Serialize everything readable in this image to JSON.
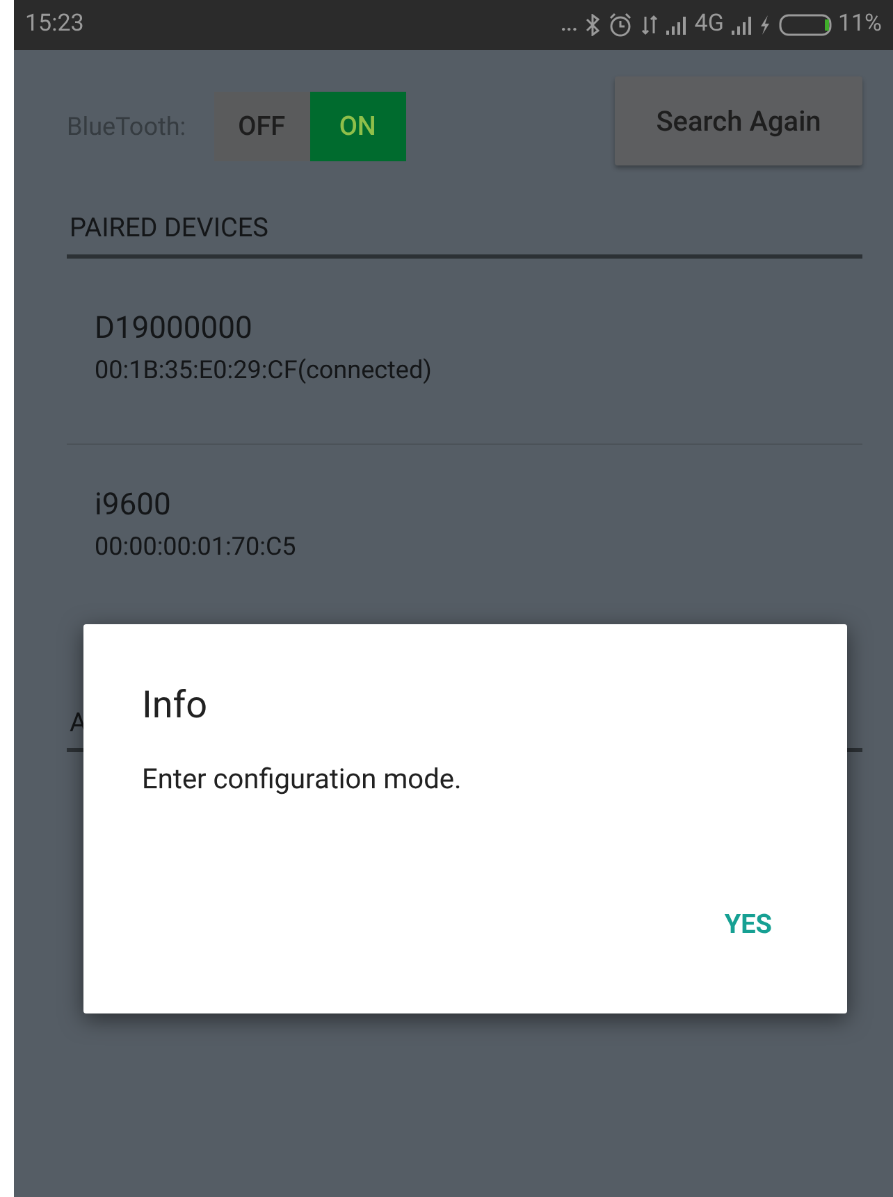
{
  "status_bar": {
    "dots": "...",
    "time": "15:23",
    "network": "4G",
    "battery": "11%"
  },
  "bluetooth": {
    "label": "BlueTooth:",
    "toggle": [
      {
        "label": "OFF",
        "selected": false
      },
      {
        "label": "ON",
        "selected": true
      }
    ]
  },
  "search_button": "Search Again",
  "sections": [
    {
      "title": "PAIRED DEVICES",
      "devices": [
        {
          "name": "D19000000",
          "address": "00:1B:35:E0:29:CF(connected)"
        },
        {
          "name": "i9600",
          "address": "00:00:00:01:70:C5"
        }
      ]
    },
    {
      "title": "A"
    }
  ],
  "dialog": {
    "title": "Info",
    "message": "Enter configuration mode.",
    "buttons": [
      "YES"
    ]
  }
}
